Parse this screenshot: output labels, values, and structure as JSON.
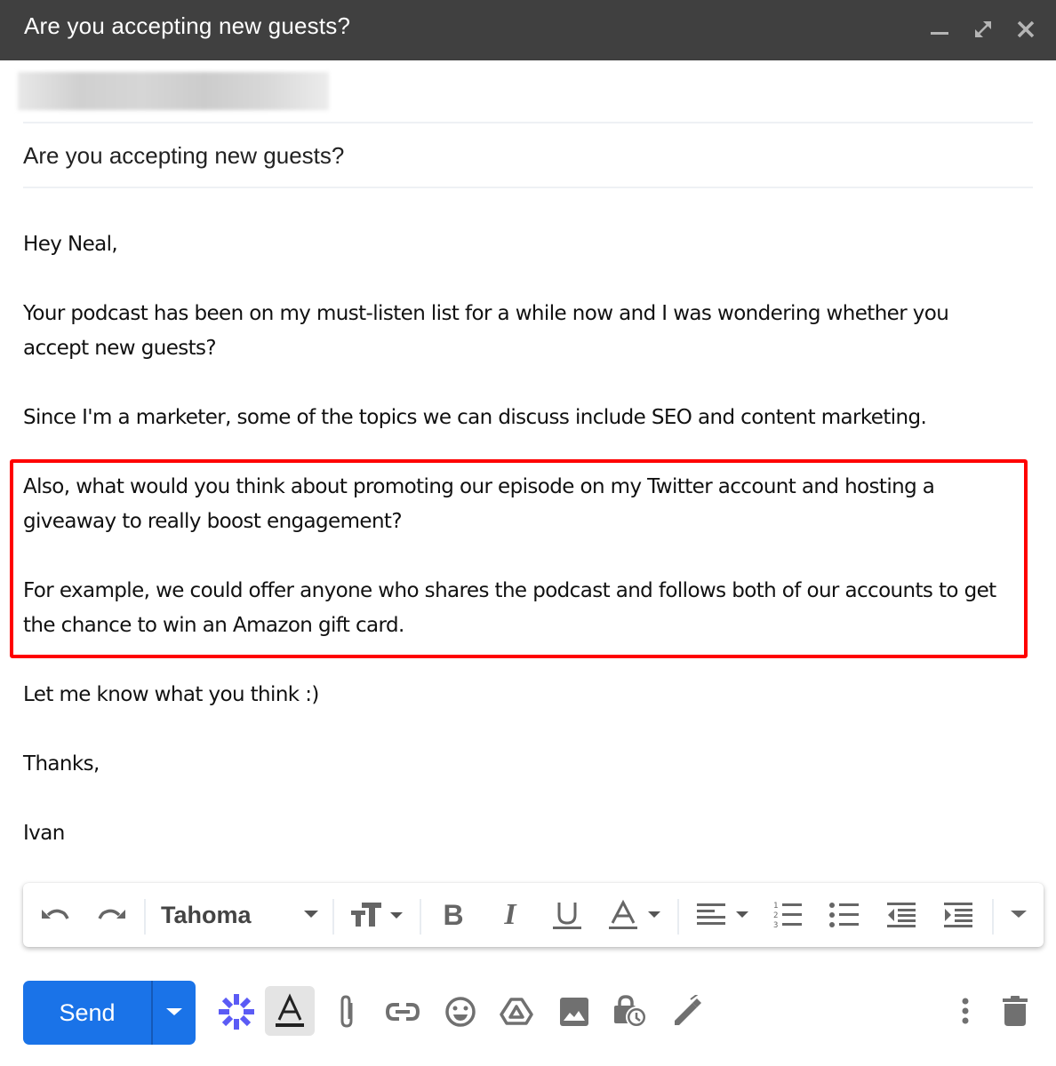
{
  "window": {
    "title": "Are you accepting new guests?",
    "controls": [
      "minimize-icon",
      "expand-icon",
      "close-icon"
    ]
  },
  "recipient": {
    "value": "[redacted – blurred]"
  },
  "subject": {
    "value": "Are you accepting new guests?"
  },
  "body": {
    "paragraphs": [
      "Hey Neal,",
      "Your podcast has been on my must-listen list for a while now and I was wondering whether you accept new guests?",
      "Since I'm a marketer, some of the topics we can discuss include SEO and content marketing.",
      "Also, what would you think about promoting our episode on my Twitter account and hosting a giveaway to really boost engagement?",
      "For example, we could offer anyone who shares the podcast and follows both of our accounts to get the chance to win an Amazon gift card.",
      "Let me know what you think :)",
      "Thanks,",
      "Ivan"
    ],
    "highlight_color": "#ff0000"
  },
  "format_toolbar": {
    "font": "Tahoma",
    "buttons": [
      "undo",
      "redo",
      "font-family",
      "font-size",
      "bold",
      "italic",
      "underline",
      "text-color",
      "align",
      "numbered-list",
      "bulleted-list",
      "indent-less",
      "indent-more",
      "more-formatting"
    ]
  },
  "actions": {
    "send_label": "Send",
    "send_color": "#1a73e8",
    "icons": [
      "integration-asterisk",
      "formatting-options",
      "attach-file",
      "insert-link",
      "insert-emoji",
      "insert-drive",
      "insert-photo",
      "confidential-mode",
      "insert-signature",
      "more-options",
      "discard-draft"
    ],
    "integration_color": "#5b5bf5"
  }
}
